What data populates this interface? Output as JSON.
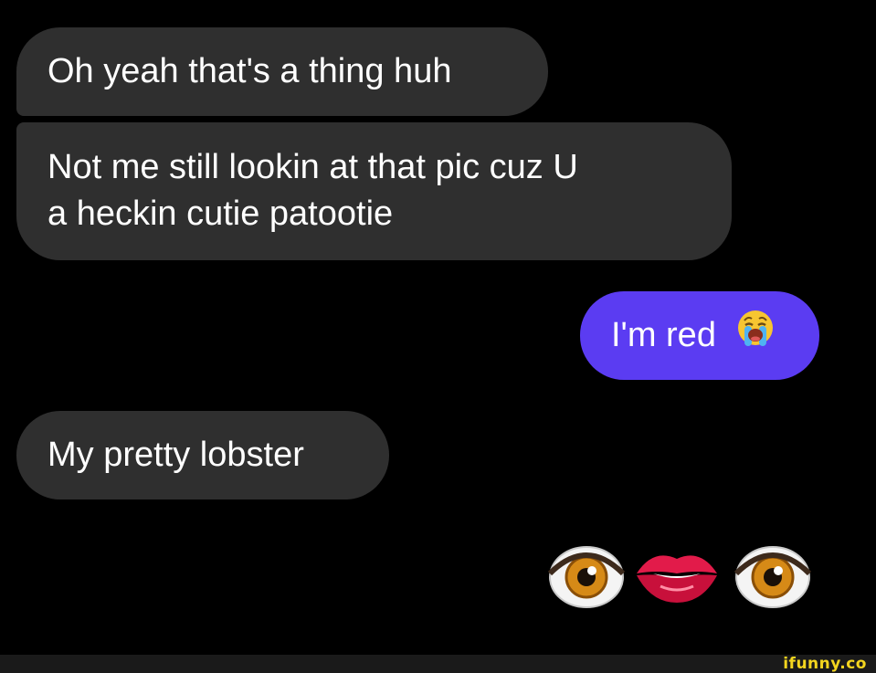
{
  "messages": [
    {
      "from": "them",
      "text": "Oh yeah that's a thing huh"
    },
    {
      "from": "them",
      "text_lines": [
        "Not me still lookin at that pic cuz U",
        "a heckin cutie patootie"
      ]
    },
    {
      "from": "me",
      "text": "I'm red",
      "emoji": "loudly-crying-face"
    },
    {
      "from": "them",
      "text": "My pretty lobster"
    },
    {
      "from": "me",
      "emoji_sequence": [
        "eye",
        "kiss-mark-lips",
        "eye"
      ]
    }
  ],
  "colors": {
    "background": "#000000",
    "received_bubble": "#2f2f2f",
    "sent_bubble": "#5b3cf2",
    "watermark": "#f3d51f"
  },
  "watermark": "ifunny.co"
}
